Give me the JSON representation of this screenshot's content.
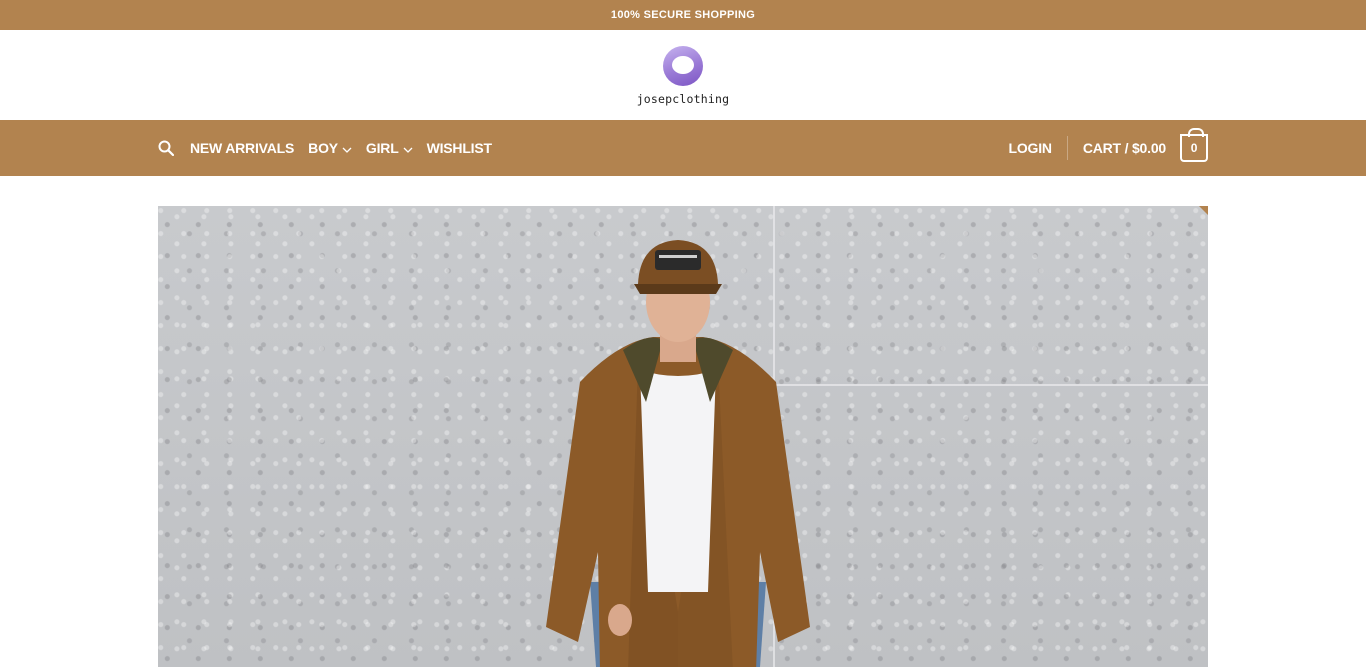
{
  "topbar": {
    "text": "100% SECURE SHOPPING"
  },
  "brand": {
    "name": "josepclothing",
    "logo_icon": "purple-ring-logo"
  },
  "nav": {
    "left": [
      {
        "label": "NEW ARRIVALS",
        "has_dropdown": false
      },
      {
        "label": "BOY",
        "has_dropdown": true
      },
      {
        "label": "GIRL",
        "has_dropdown": true
      },
      {
        "label": "WISHLIST",
        "has_dropdown": false
      }
    ],
    "login_label": "LOGIN",
    "cart_label": "CART / $0.00",
    "cart_count": "0"
  },
  "hero": {
    "image": "man-in-brown-jacket-and-cap-against-terrazzo-wall"
  },
  "colors": {
    "accent": "#b2834f",
    "background": "#ffffff"
  }
}
